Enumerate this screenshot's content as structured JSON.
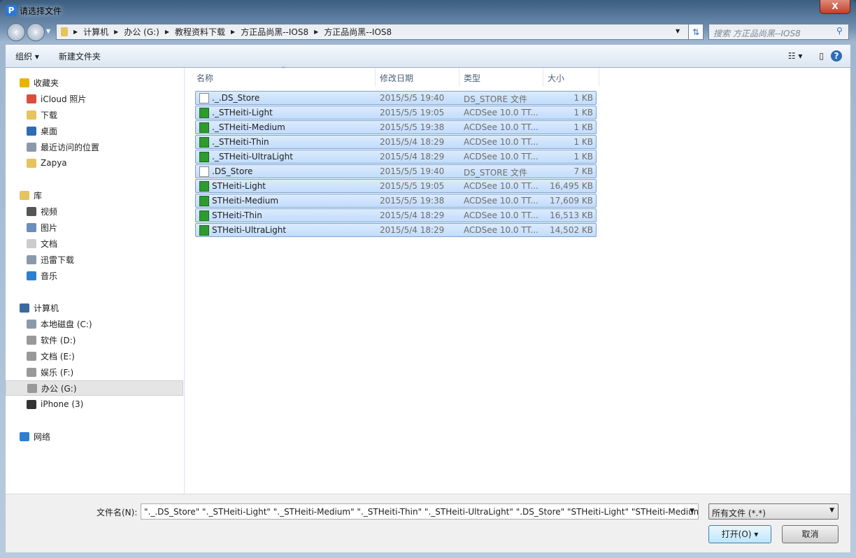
{
  "window": {
    "title": "请选择文件",
    "close": "X"
  },
  "address": {
    "path": [
      "计算机",
      "办公 (G:)",
      "教程资料下载",
      "方正品尚黑--IOS8",
      "方正品尚黑--IOS8"
    ],
    "search_placeholder": "搜索 方正品尚黑--IOS8"
  },
  "toolbar": {
    "organize": "组织 ▾",
    "new_folder": "新建文件夹"
  },
  "sidebar": {
    "items": [
      {
        "label": "收藏夹",
        "group": true,
        "color": "#e8b400"
      },
      {
        "label": "iCloud 照片",
        "color": "#d94f3a"
      },
      {
        "label": "下载",
        "color": "#e6c35c"
      },
      {
        "label": "桌面",
        "color": "#2d6cb5"
      },
      {
        "label": "最近访问的位置",
        "color": "#8a9aab"
      },
      {
        "label": "Zapya",
        "color": "#e6c35c"
      },
      {
        "label": "库",
        "group": true,
        "color": "#e6c35c"
      },
      {
        "label": "视频",
        "color": "#555"
      },
      {
        "label": "图片",
        "color": "#6a8fb8"
      },
      {
        "label": "文档",
        "color": "#ccc"
      },
      {
        "label": "迅雷下载",
        "color": "#8a9aab"
      },
      {
        "label": "音乐",
        "color": "#2d7fd0"
      },
      {
        "label": "计算机",
        "group": true,
        "color": "#3b6aa0"
      },
      {
        "label": "本地磁盘 (C:)",
        "color": "#8a9aab"
      },
      {
        "label": "软件 (D:)",
        "color": "#999"
      },
      {
        "label": "文档 (E:)",
        "color": "#999"
      },
      {
        "label": "娱乐 (F:)",
        "color": "#999"
      },
      {
        "label": "办公 (G:)",
        "color": "#999",
        "selected": true
      },
      {
        "label": "iPhone (3)",
        "color": "#333"
      },
      {
        "label": "网络",
        "group": true,
        "color": "#2d7fd0"
      }
    ]
  },
  "columns": [
    "名称",
    "修改日期",
    "类型",
    "大小"
  ],
  "files": [
    {
      "name": "._.DS_Store",
      "date": "2015/5/5 19:40",
      "type": "DS_STORE 文件",
      "size": "1 KB",
      "ttf": false
    },
    {
      "name": "._STHeiti-Light",
      "date": "2015/5/5 19:05",
      "type": "ACDSee 10.0 TT...",
      "size": "1 KB",
      "ttf": true
    },
    {
      "name": "._STHeiti-Medium",
      "date": "2015/5/5 19:38",
      "type": "ACDSee 10.0 TT...",
      "size": "1 KB",
      "ttf": true
    },
    {
      "name": "._STHeiti-Thin",
      "date": "2015/5/4 18:29",
      "type": "ACDSee 10.0 TT...",
      "size": "1 KB",
      "ttf": true
    },
    {
      "name": "._STHeiti-UltraLight",
      "date": "2015/5/4 18:29",
      "type": "ACDSee 10.0 TT...",
      "size": "1 KB",
      "ttf": true
    },
    {
      "name": ".DS_Store",
      "date": "2015/5/5 19:40",
      "type": "DS_STORE 文件",
      "size": "7 KB",
      "ttf": false
    },
    {
      "name": "STHeiti-Light",
      "date": "2015/5/5 19:05",
      "type": "ACDSee 10.0 TT...",
      "size": "16,495 KB",
      "ttf": true
    },
    {
      "name": "STHeiti-Medium",
      "date": "2015/5/5 19:38",
      "type": "ACDSee 10.0 TT...",
      "size": "17,609 KB",
      "ttf": true
    },
    {
      "name": "STHeiti-Thin",
      "date": "2015/5/4 18:29",
      "type": "ACDSee 10.0 TT...",
      "size": "16,513 KB",
      "ttf": true
    },
    {
      "name": "STHeiti-UltraLight",
      "date": "2015/5/4 18:29",
      "type": "ACDSee 10.0 TT...",
      "size": "14,502 KB",
      "ttf": true
    }
  ],
  "bottom": {
    "filename_label": "文件名(N):",
    "filename_value": "\"._.DS_Store\" \"._STHeiti-Light\" \"._STHeiti-Medium\" \"._STHeiti-Thin\" \"._STHeiti-UltraLight\" \".DS_Store\" \"STHeiti-Light\" \"STHeiti-Medium\" \"S",
    "filter": "所有文件 (*.*)",
    "open": "打开(O)",
    "cancel": "取消"
  }
}
